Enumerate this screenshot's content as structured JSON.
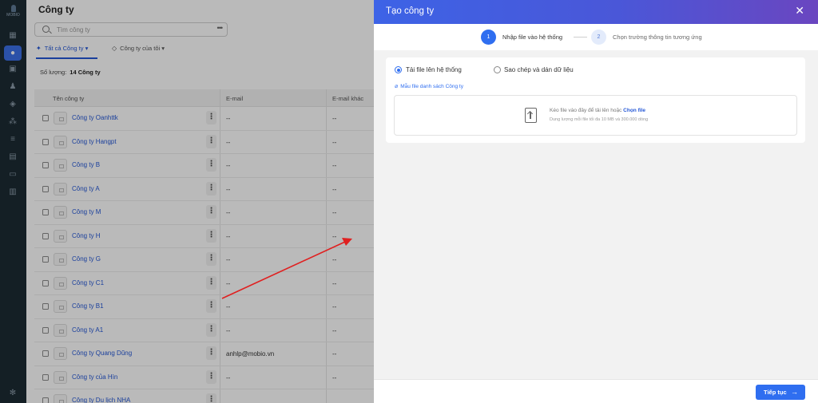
{
  "sidebar": {
    "logo_text": "MOBIO"
  },
  "page": {
    "title": "Công ty",
    "search_placeholder": "Tìm công ty",
    "tabs": [
      {
        "label": "Tất cả Công ty"
      },
      {
        "label": "Công ty của tôi"
      }
    ],
    "count_label": "Số lượng:",
    "count_value": "14 Công ty",
    "columns": [
      "Tên công ty",
      "E-mail",
      "E-mail khác"
    ],
    "rows": [
      {
        "name": "Công ty Oanhttk",
        "email": "--",
        "email_other": "--"
      },
      {
        "name": "Công ty Hangpt",
        "email": "--",
        "email_other": "--"
      },
      {
        "name": "Công ty B",
        "email": "--",
        "email_other": "--"
      },
      {
        "name": "Công ty A",
        "email": "--",
        "email_other": "--"
      },
      {
        "name": "Công ty M",
        "email": "--",
        "email_other": "--"
      },
      {
        "name": "Công ty H",
        "email": "--",
        "email_other": "--"
      },
      {
        "name": "Công ty G",
        "email": "--",
        "email_other": "--"
      },
      {
        "name": "Công ty C1",
        "email": "--",
        "email_other": "--"
      },
      {
        "name": "Công ty B1",
        "email": "--",
        "email_other": "--"
      },
      {
        "name": "Công ty A1",
        "email": "--",
        "email_other": "--"
      },
      {
        "name": "Công ty Quang Dũng",
        "email": "anhlp@mobio.vn",
        "email_other": "--"
      },
      {
        "name": "Công ty của Hìn",
        "email": "--",
        "email_other": "--"
      },
      {
        "name": "Công ty Du lịch NHA",
        "email": "",
        "email_other": ""
      }
    ]
  },
  "drawer": {
    "title": "Tạo công ty",
    "close_icon": "close-icon",
    "steps": [
      {
        "number": "1",
        "label": "Nhập file vào hệ thống"
      },
      {
        "number": "2",
        "label": "Chọn trường thông tin tương ứng"
      }
    ],
    "options": [
      {
        "label": "Tải file lên hệ thống",
        "selected": true
      },
      {
        "label": "Sao chép và dán dữ liệu",
        "selected": false
      }
    ],
    "template_link": "Mẫu file danh sách Công ty",
    "drop_text": "Kéo file vào đây để tải lên hoặc",
    "drop_link": "Chọn file",
    "drop_hint": "Dung lượng mỗi file tối đa 10 MB và 300.000 dòng",
    "next_button": "Tiếp tục"
  },
  "colors": {
    "accent": "#2f6ef0",
    "header_start": "#3d63e6",
    "header_end": "#6a46c0",
    "annotation": "#e02020"
  }
}
